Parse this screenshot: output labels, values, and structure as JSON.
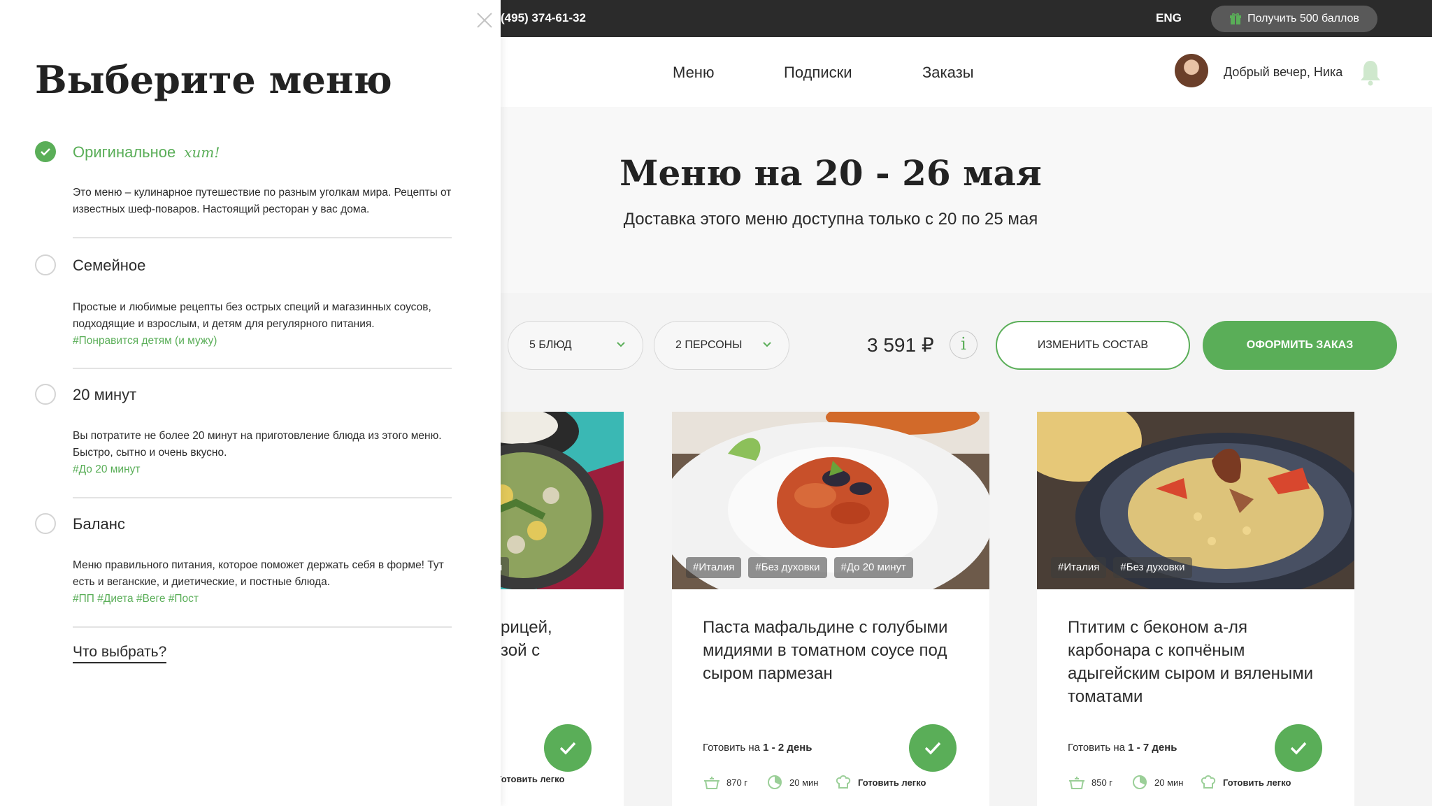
{
  "topbar": {
    "phone": "(495) 374-61-32",
    "lang": "ENG",
    "bonus_label": "Получить 500 баллов"
  },
  "header": {
    "nav": [
      "Меню",
      "Подписки",
      "Заказы"
    ],
    "greeting": "Добрый вечер, Ника"
  },
  "hero": {
    "title": "Меню на 20 - 26 мая",
    "subtitle": "Доставка этого меню доступна только с 20 по 25 мая"
  },
  "controls": {
    "dishes_select": "5 БЛЮД",
    "persons_select": "2 ПЕРСОНЫ",
    "price": "3 591 ₽",
    "info_glyph": "i",
    "change_label": "ИЗМЕНИТЬ СОСТАВ",
    "order_label": "ОФОРМИТЬ ЗАКАЗ"
  },
  "cards": [
    {
      "tags": [
        "#Италия",
        "#Без духовки",
        "#До 20 минут"
      ],
      "title": "Паста мафальдине с голубыми мидиями в томатном соусе под сыром пармезан",
      "cook_prefix": "Готовить на ",
      "cook_days": "1 - 2 день",
      "weight": "870 г",
      "time": "20 мин",
      "difficulty": "Готовить легко"
    },
    {
      "tags": [
        "#Италия",
        "#Без духовки"
      ],
      "title": "Птитим с беконом а-ля карбонара с копчёным адыгейским сыром и вялеными томатами",
      "cook_prefix": "Готовить на ",
      "cook_days": "1 - 7 день",
      "weight": "850 г",
      "time": "20 мин",
      "difficulty": "Готовить легко"
    }
  ],
  "partial_card": {
    "tag_fragment": "и",
    "title_fragment_1": "рицей,",
    "title_fragment_2": "зой с",
    "difficulty": "Готовить легко"
  },
  "drawer": {
    "title": "Выберите меню",
    "options": [
      {
        "label": "Оригинальное",
        "badge": "хит!",
        "selected": true,
        "desc": "Это меню – кулинарное путешествие по разным уголкам мира. Рецепты от известных шеф-поваров. Настоящий ресторан у вас дома.",
        "tags": ""
      },
      {
        "label": "Семейное",
        "selected": false,
        "desc": "Простые и любимые рецепты без острых специй и магазинных соусов, подходящие и взрослым, и детям для регулярного питания.",
        "tags": "#Понравится детям (и мужу)"
      },
      {
        "label": "20 минут",
        "selected": false,
        "desc": "Вы потратите не более 20 минут на приготовление блюда из этого меню. Быстро, сытно и очень вкусно.",
        "tags": "#До 20 минут"
      },
      {
        "label": "Баланс",
        "selected": false,
        "desc": "Меню правильного питания, которое поможет держать себя в форме! Тут есть и веганские, и диетические, и постные блюда.",
        "tags": "#ПП #Диета #Веге #Пост"
      }
    ],
    "what_link": "Что выбрать?"
  },
  "colors": {
    "accent_green": "#5aae58",
    "topbar_bg": "#2b2b2b",
    "text": "#2b2b2b"
  }
}
